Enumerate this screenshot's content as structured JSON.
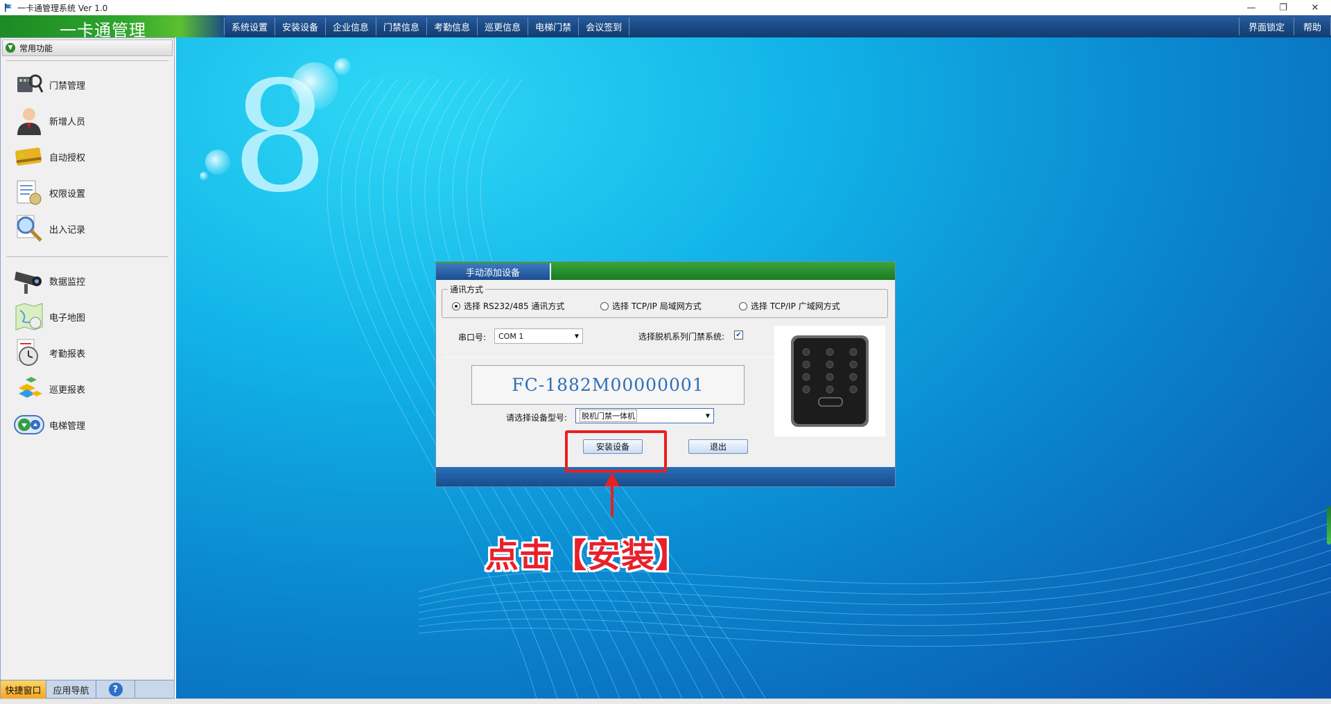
{
  "window": {
    "title": "一卡通管理系统 Ver 1.0",
    "controls": {
      "minimize": "—",
      "restore": "❐",
      "close": "✕"
    }
  },
  "menubar": {
    "brand": "一卡通管理",
    "items": [
      "系统设置",
      "安装设备",
      "企业信息",
      "门禁信息",
      "考勤信息",
      "巡更信息",
      "电梯门禁",
      "会议签到"
    ],
    "right_items": [
      "界面锁定",
      "帮助"
    ]
  },
  "sidebar": {
    "header": "常用功能",
    "group1": [
      {
        "label": "门禁管理",
        "icon": "access-control-icon"
      },
      {
        "label": "新增人员",
        "icon": "person-icon"
      },
      {
        "label": "自动授权",
        "icon": "card-icon"
      },
      {
        "label": "权限设置",
        "icon": "document-icon"
      },
      {
        "label": "出入记录",
        "icon": "magnifier-icon"
      }
    ],
    "group2": [
      {
        "label": "数据监控",
        "icon": "camera-icon"
      },
      {
        "label": "电子地图",
        "icon": "map-icon"
      },
      {
        "label": "考勤报表",
        "icon": "clock-icon"
      },
      {
        "label": "巡更报表",
        "icon": "cubes-icon"
      },
      {
        "label": "电梯管理",
        "icon": "elevator-icon"
      }
    ],
    "bottom_tabs": {
      "quick": "快捷窗口",
      "nav": "应用导航",
      "help": "?"
    }
  },
  "dialog": {
    "tab": "手动添加设备",
    "comm_group_label": "通讯方式",
    "radios": [
      {
        "label": "选择 RS232/485 通讯方式",
        "checked": true
      },
      {
        "label": "选择 TCP/IP 局域网方式",
        "checked": false
      },
      {
        "label": "选择 TCP/IP 广域网方式",
        "checked": false
      }
    ],
    "port_label": "串口号:",
    "port_value": "COM 1",
    "offline_label": "选择脱机系列门禁系统:",
    "offline_checked": true,
    "device_code": "FC-1882M00000001",
    "model_label": "请选择设备型号:",
    "model_value": "脱机门禁一体机",
    "install_button": "安装设备",
    "exit_button": "退出"
  },
  "annotation": {
    "text": "点击【安装】",
    "color": "#e8202a"
  }
}
